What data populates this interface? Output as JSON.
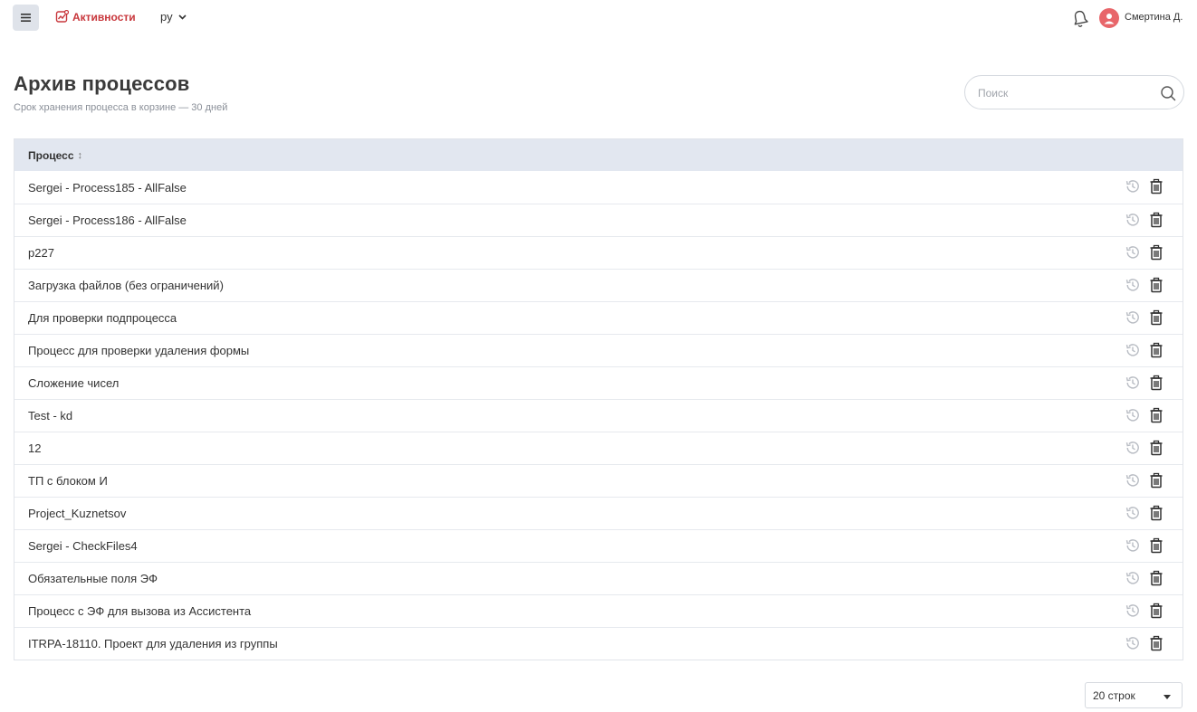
{
  "topbar": {
    "brand_label": "Активности",
    "language": "ру",
    "user_name": "Смертина Д."
  },
  "header": {
    "title": "Архив процессов",
    "subtitle": "Срок хранения процесса в корзине — 30 дней"
  },
  "search": {
    "placeholder": "Поиск",
    "value": ""
  },
  "table": {
    "column_header": "Процесс",
    "sort_glyph": "↕",
    "rows": [
      "Sergei - Process185 - AllFalse",
      "Sergei - Process186 - AllFalse",
      "p227",
      "Загрузка файлов (без ограничений)",
      "Для проверки подпроцесса",
      "Процесс для проверки удаления формы",
      "Сложение чисел",
      "Test - kd",
      "12",
      "ТП с блоком И",
      "Project_Kuznetsov",
      "Sergei - CheckFiles4",
      "Обязательные поля ЭФ",
      "Процесс с ЭФ для вызова из Ассистента",
      "ITRPA-18110. Проект для удаления из группы"
    ],
    "row_actions": [
      "restore-icon",
      "trash-icon"
    ]
  },
  "pager": {
    "rows_per_page": "20 строк"
  },
  "colors": {
    "brand": "#c8373c",
    "header_bg": "#e2e7f0",
    "avatar": "#e8666a",
    "menu_button_bg": "#dfe3ea"
  }
}
